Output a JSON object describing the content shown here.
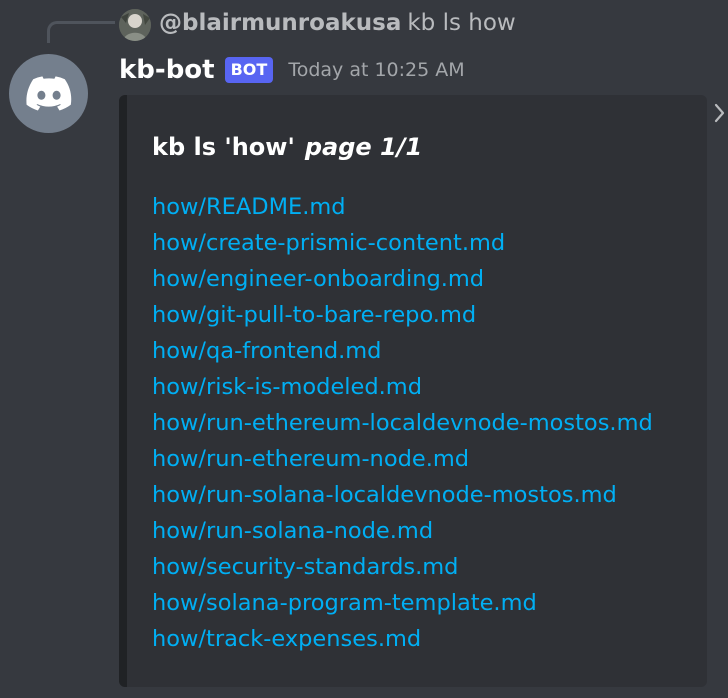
{
  "reply": {
    "username": "@blairmunroakusa",
    "text": "kb ls how"
  },
  "message": {
    "username": "kb-bot",
    "badge": "BOT",
    "timestamp": "Today at 10:25 AM"
  },
  "embed": {
    "title": "kb ls 'how'",
    "page_info": "page 1/1",
    "links": [
      "how/README.md",
      "how/create-prismic-content.md",
      "how/engineer-onboarding.md",
      "how/git-pull-to-bare-repo.md",
      "how/qa-frontend.md",
      "how/risk-is-modeled.md",
      "how/run-ethereum-localdevnode-mostos.md",
      "how/run-ethereum-node.md",
      "how/run-solana-localdevnode-mostos.md",
      "how/run-solana-node.md",
      "how/security-standards.md",
      "how/solana-program-template.md",
      "how/track-expenses.md"
    ]
  },
  "colors": {
    "background": "#36393f",
    "embed_background": "#2f3136",
    "link": "#00aff4",
    "badge": "#5865f2",
    "avatar": "#747f8d"
  },
  "icons": {
    "bot_avatar": "discord-logo-icon",
    "reply_avatar": "user-avatar",
    "side_arrow": "chevron-right-icon"
  }
}
